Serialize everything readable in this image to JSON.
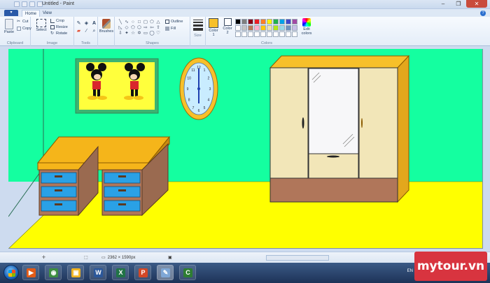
{
  "window": {
    "title": "Untitled - Paint",
    "controls": [
      "–",
      "❐",
      "✕"
    ]
  },
  "tabs": [
    {
      "label": "Home",
      "active": true
    },
    {
      "label": "View",
      "active": false
    }
  ],
  "ribbon": {
    "clipboard": {
      "paste": "Paste",
      "cut": "Cut",
      "copy": "Copy",
      "label": "Clipboard"
    },
    "image": {
      "select": "Select",
      "crop": "Crop",
      "resize": "Resize",
      "rotate": "Rotate",
      "label": "Image"
    },
    "tools": {
      "label": "Tools",
      "brushes": "Brushes"
    },
    "shapes": {
      "outline": "Outline",
      "fill": "Fill",
      "label": "Shapes"
    },
    "size": {
      "label": "Size"
    },
    "colors": {
      "color1_label": "Color",
      "color1_num": "1",
      "color2_label": "Color",
      "color2_num": "2",
      "edit_label": "Edit",
      "edit_sub": "colors",
      "label": "Colors",
      "color1": "#f7c02a",
      "color2": "#ffffff",
      "palette": [
        "#000000",
        "#7f7f7f",
        "#880015",
        "#ed1c24",
        "#ff7f27",
        "#fff200",
        "#22b14c",
        "#00a2e8",
        "#3f48cc",
        "#a349a4",
        "#ffffff",
        "#c3c3c3",
        "#b97a57",
        "#ffaec9",
        "#ffc90e",
        "#efe4b0",
        "#b5e61d",
        "#99d9ea",
        "#7092be",
        "#c8bfe7",
        "#ffffff",
        "#ffffff",
        "#ffffff",
        "#ffffff",
        "#ffffff",
        "#ffffff",
        "#ffffff",
        "#ffffff",
        "#ffffff",
        "#ffffff"
      ]
    }
  },
  "canvas": {
    "wall_color": "#14ffa0",
    "floor_color": "#ffff00"
  },
  "status": {
    "dimensions": "2362 × 1590px"
  },
  "taskbar": {
    "apps": [
      {
        "name": "media-player-icon",
        "color": "#e45b17",
        "glyph": "▶"
      },
      {
        "name": "chrome-icon",
        "color": "#3e8e41",
        "glyph": "◉"
      },
      {
        "name": "explorer-icon",
        "color": "#f0b323",
        "glyph": "▣"
      },
      {
        "name": "word-icon",
        "color": "#2b579a",
        "glyph": "W"
      },
      {
        "name": "excel-icon",
        "color": "#217346",
        "glyph": "X"
      },
      {
        "name": "powerpoint-icon",
        "color": "#d24726",
        "glyph": "P"
      },
      {
        "name": "paint-icon",
        "color": "#7fa7d6",
        "glyph": "✎"
      },
      {
        "name": "camtasia-icon",
        "color": "#2e7d32",
        "glyph": "C"
      }
    ],
    "language": "EN"
  },
  "watermark": {
    "text": "mytour.vn"
  }
}
